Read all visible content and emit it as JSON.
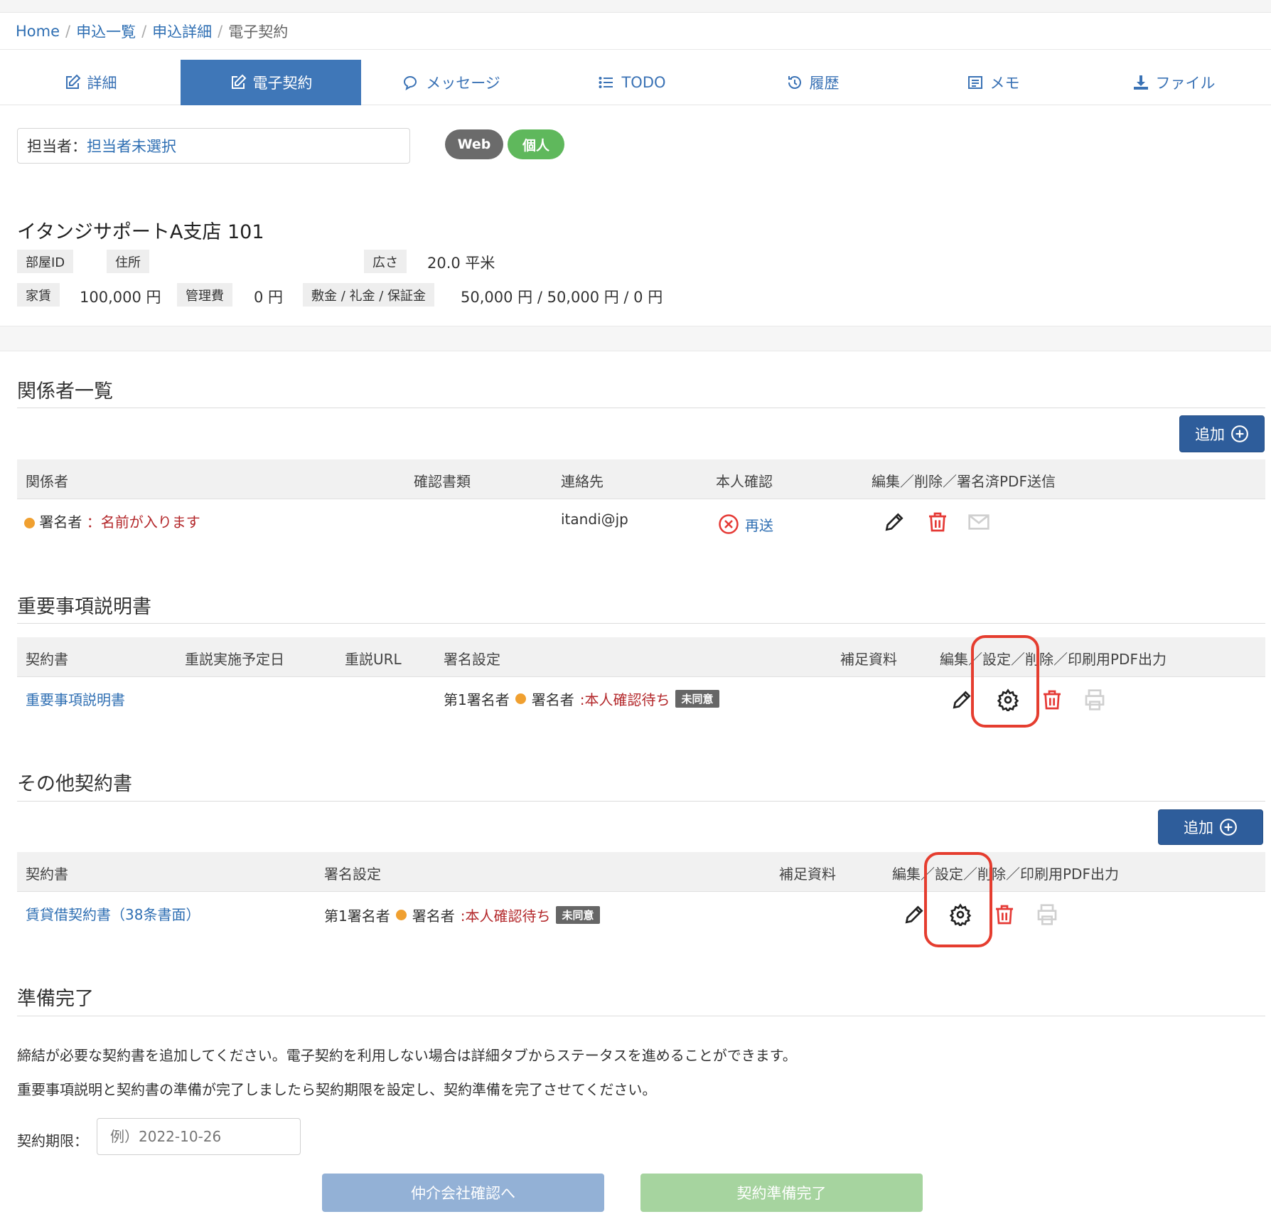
{
  "breadcrumb": {
    "home": "Home",
    "list": "申込一覧",
    "detail": "申込詳細",
    "current": "電子契約"
  },
  "tabs": [
    {
      "label": "詳細",
      "icon": "edit-icon"
    },
    {
      "label": "電子契約",
      "icon": "edit-icon"
    },
    {
      "label": "メッセージ",
      "icon": "chat-icon"
    },
    {
      "label": "TODO",
      "icon": "list-icon"
    },
    {
      "label": "履歴",
      "icon": "history-icon"
    },
    {
      "label": "メモ",
      "icon": "memo-icon"
    },
    {
      "label": "ファイル",
      "icon": "download-icon"
    }
  ],
  "assignee": {
    "label": "担当者：",
    "value": "担当者未選択"
  },
  "badges": {
    "web": "Web",
    "personal": "個人"
  },
  "property": {
    "name": "イタンジサポートA支店 101",
    "room_id_label": "部屋ID",
    "room_id_value": "",
    "address_label": "住所",
    "address_value": "",
    "area_label": "広さ",
    "area_value": "20.0 平米",
    "rent_label": "家賃",
    "rent_value": "100,000 円",
    "mgmt_label": "管理費",
    "mgmt_value": "0 円",
    "deposit_label": "敷金 / 礼金 / 保証金",
    "deposit_value": "50,000 円 / 50,000 円 / 0 円"
  },
  "parties": {
    "title": "関係者一覧",
    "add_label": "追加",
    "headers": [
      "関係者",
      "確認書類",
      "連絡先",
      "本人確認",
      "編集／削除／署名済PDF送信"
    ],
    "row": {
      "role": "署名者",
      "sep": "：",
      "name": "名前が入ります",
      "docs": "",
      "contact": "itandi@jp",
      "identity": "再送"
    }
  },
  "important": {
    "title": "重要事項説明書",
    "headers": [
      "契約書",
      "重説実施予定日",
      "重説URL",
      "署名設定",
      "補足資料",
      "編集／設定／削除／印刷用PDF出力"
    ],
    "row": {
      "doc": "重要事項説明書",
      "date": "",
      "url": "",
      "signer_order": "第1署名者",
      "signer_role": "署名者",
      "status": ":本人確認待ち",
      "badge": "未同意",
      "extra": ""
    }
  },
  "others": {
    "title": "その他契約書",
    "add_label": "追加",
    "headers": [
      "契約書",
      "署名設定",
      "補足資料",
      "編集／設定／削除／印刷用PDF出力"
    ],
    "row": {
      "doc": "賃貸借契約書（38条書面）",
      "signer_order": "第1署名者",
      "signer_role": "署名者",
      "status": ":本人確認待ち",
      "badge": "未同意",
      "extra": ""
    }
  },
  "ready": {
    "title": "準備完了",
    "note1": "締結が必要な契約書を追加してください。電子契約を利用しない場合は詳細タブからステータスを進めることができます。",
    "note2": "重要事項説明と契約書の準備が完了しましたら契約期限を設定し、契約準備を完了させてください。",
    "deadline_label": "契約期限：",
    "deadline_placeholder": "例）2022-10-26",
    "btn_broker": "仲介会社確認へ",
    "btn_complete": "契約準備完了"
  },
  "colors": {
    "primary": "#3f77b8",
    "add_button": "#2e5d9b",
    "badge_web": "#6b6b6b",
    "badge_personal": "#5fb85c",
    "danger": "#e53935",
    "highlight": "#e53d2f"
  }
}
